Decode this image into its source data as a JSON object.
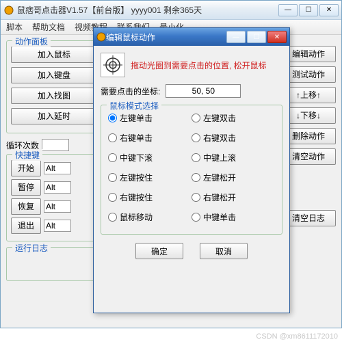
{
  "main": {
    "title": "鼠痞哥点击器V1.57【前台版】   yyyy001  剩余365天",
    "menu": [
      "脚本",
      "帮助文档",
      "视频教程",
      "联系我们",
      "最小化"
    ],
    "panel_title": "动作面板",
    "add_buttons": [
      "加入鼠标",
      "加入键盘",
      "加入找图",
      "加入延时"
    ],
    "loop_label": "循环次数",
    "hotkey_title": "快捷键",
    "hotkeys": [
      {
        "name": "开始",
        "key": "Alt"
      },
      {
        "name": "暂停",
        "key": "Alt"
      },
      {
        "name": "恢复",
        "key": "Alt"
      },
      {
        "name": "退出",
        "key": "Alt"
      }
    ],
    "log_title": "运行日志",
    "right_buttons": [
      "编辑动作",
      "测试动作",
      "↑上移↑",
      "↓下移↓",
      "删除动作",
      "清空动作",
      "清空日志"
    ]
  },
  "dialog": {
    "title": "编辑鼠标动作",
    "hint": "拖动光圈到需要点击的位置, 松开鼠标",
    "coord_label": "需要点击的坐标:",
    "coord_value": "50, 50",
    "mode_title": "鼠标模式选择",
    "options": [
      [
        "左键单击",
        "左键双击"
      ],
      [
        "右键单击",
        "右键双击"
      ],
      [
        "中键下滚",
        "中键上滚"
      ],
      [
        "左键按住",
        "左键松开"
      ],
      [
        "右键按住",
        "右键松开"
      ],
      [
        "鼠标移动",
        "中键单击"
      ]
    ],
    "ok": "确定",
    "cancel": "取消"
  },
  "watermark": "CSDN @xm8611172010"
}
